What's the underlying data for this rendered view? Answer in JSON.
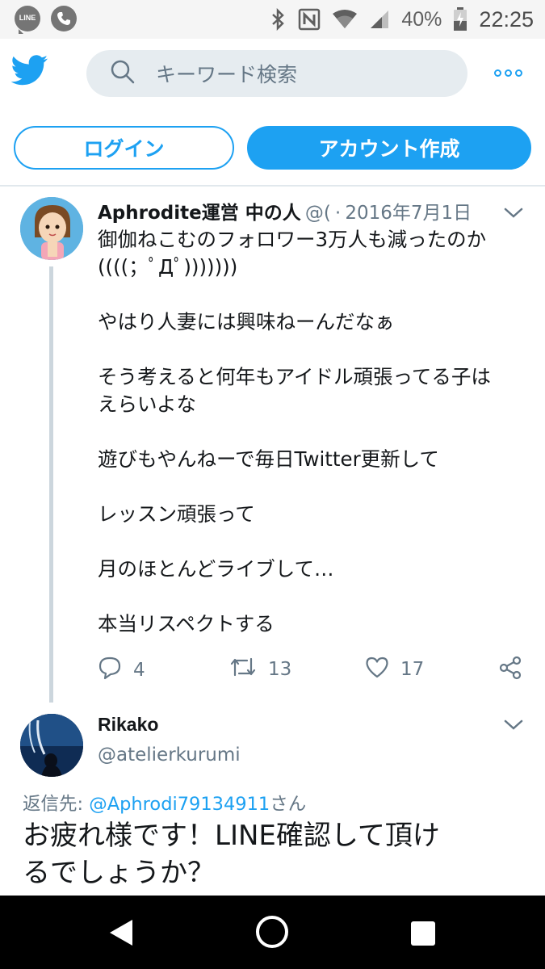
{
  "status_bar": {
    "line_label": "LINE",
    "battery_percent": "40%",
    "time": "22:25",
    "icons": [
      "line-app-icon",
      "phone-icon",
      "bluetooth-icon",
      "nfc-icon",
      "wifi-icon",
      "signal-icon",
      "battery-charging-icon"
    ]
  },
  "header": {
    "search_placeholder": "キーワード検索",
    "icons": [
      "twitter-bird-icon",
      "search-icon",
      "more-icon"
    ]
  },
  "auth": {
    "login_label": "ログイン",
    "signup_label": "アカウント作成"
  },
  "tweet1": {
    "name": "Aphrodite運営 中の人",
    "handle": "@(",
    "separator": "·",
    "date": "2016年7月1日",
    "lines": [
      "御伽ねこむのフォロワー3万人も減ったのか",
      "((((；ﾟДﾟ)))))))",
      "",
      "やはり人妻には興味ねーんだなぁ",
      "",
      "そう考えると何年もアイドル頑張ってる子は",
      "えらいよな",
      "",
      "遊びもやんねーで毎日Twitter更新して",
      "",
      "レッスン頑張って",
      "",
      "月のほとんどライブして…",
      "",
      "本当リスペクトする"
    ],
    "replies": "4",
    "retweets": "13",
    "likes": "17"
  },
  "tweet2": {
    "name": "Rikako",
    "handle": "@atelierkurumi",
    "reply_prefix": "返信先: ",
    "reply_mention": "@Aphrodi79134911",
    "reply_suffix": "さん",
    "line1": "お疲れ様です！LINE確認して頂け",
    "line2": "るでしょうか？"
  },
  "colors": {
    "accent": "#1da1f2",
    "muted": "#657786",
    "divider": "#e1e8ed",
    "search_bg": "#e6ecf0"
  }
}
